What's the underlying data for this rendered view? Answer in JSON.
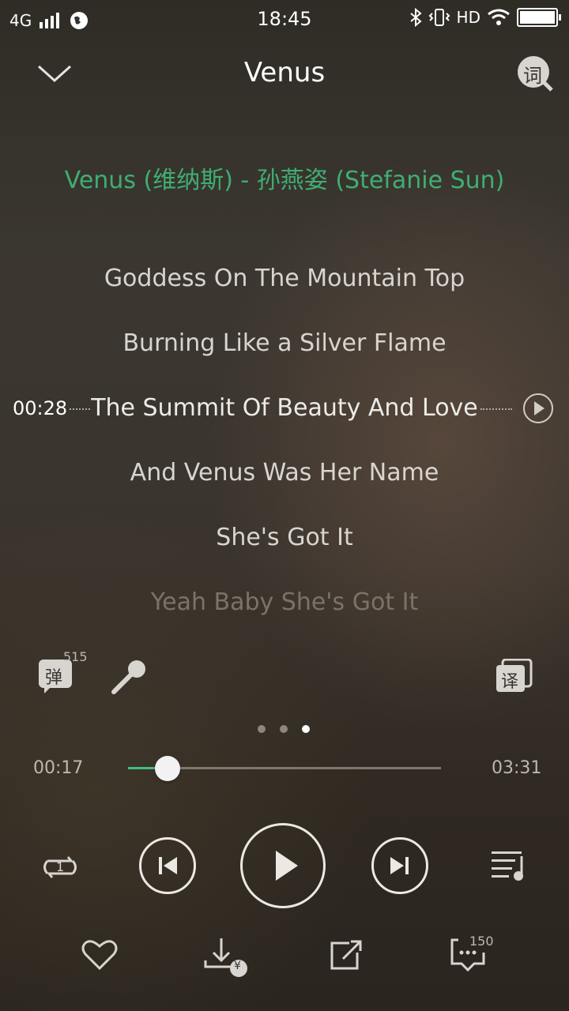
{
  "status_bar": {
    "network": "4G",
    "time": "18:45",
    "hd": "HD"
  },
  "header": {
    "title": "Venus",
    "lyrics_search_label": "词"
  },
  "lyrics": {
    "lines": [
      "Venus (维纳斯) - 孙燕姿 (Stefanie Sun)",
      "Goddess On The Mountain Top",
      "Burning Like a Silver Flame",
      "The Summit Of Beauty And Love",
      "And Venus Was Her Name",
      "She's Got It",
      "Yeah Baby She's Got It"
    ],
    "seek_time": "00:28"
  },
  "tools": {
    "danmaku_label": "弹",
    "danmaku_count": "515",
    "translate_label": "译"
  },
  "pager": {
    "count": 3,
    "active": 2
  },
  "player": {
    "elapsed": "00:17",
    "duration": "03:31",
    "progress": 0.086,
    "loop_badge": "1"
  },
  "actions": {
    "comment_count": "150",
    "download_badge": "¥"
  },
  "colors": {
    "accent": "#3fae73",
    "progress": "#3fbf7f"
  }
}
